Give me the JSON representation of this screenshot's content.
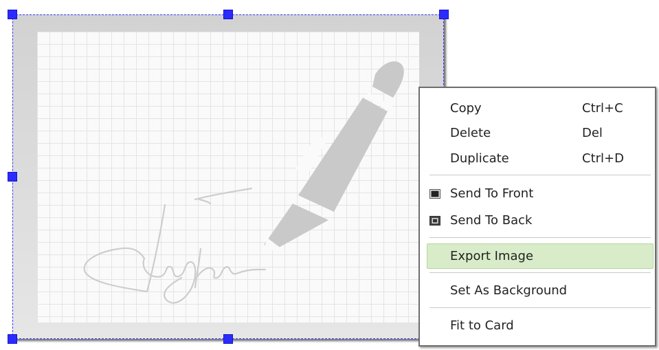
{
  "context_menu": {
    "copy": {
      "label": "Copy",
      "shortcut": "Ctrl+C"
    },
    "delete": {
      "label": "Delete",
      "shortcut": "Del"
    },
    "duplicate": {
      "label": "Duplicate",
      "shortcut": "Ctrl+D"
    },
    "send_to_front": {
      "label": "Send To Front",
      "icon": "send-to-front-icon"
    },
    "send_to_back": {
      "label": "Send To Back",
      "icon": "send-to-back-icon"
    },
    "export_image": {
      "label": "Export Image",
      "highlighted": true
    },
    "set_as_background": {
      "label": "Set As Background"
    },
    "fit_to_card": {
      "label": "Fit to Card"
    }
  },
  "selected_image": {
    "content": "signature-pen-image"
  },
  "colors": {
    "selection_handle": "#2b2bff",
    "highlight": "#d9ecc9"
  }
}
